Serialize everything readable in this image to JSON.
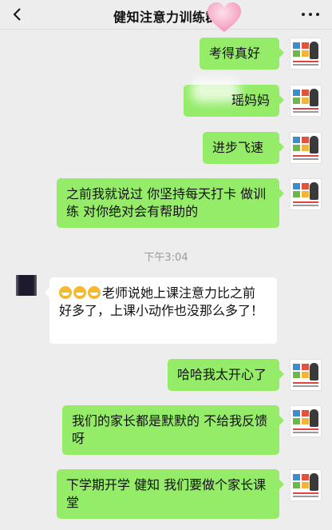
{
  "header": {
    "title": "健知注意力训练群",
    "back_icon": "chevron-left-icon",
    "more_icon": "more-dots-icon",
    "heart_color": "#f7a9c6"
  },
  "messages": [
    {
      "sender": "me",
      "text": "考得真好"
    },
    {
      "sender": "me",
      "text": "瑶妈妈"
    },
    {
      "sender": "me",
      "text": "进步飞速"
    },
    {
      "sender": "me",
      "text": "之前我就说过 你坚持每天打卡 做训练 对你绝对会有帮助的"
    },
    {
      "sender": "other",
      "text": "老师说她上课注意力比之前好多了，上课小动作也没那么多了！",
      "emoji_count": 3
    },
    {
      "sender": "me",
      "text": "哈哈我太开心了"
    },
    {
      "sender": "me",
      "text": "我们的家长都是默默的 不给我反馈呀"
    },
    {
      "sender": "me",
      "text": "下学期开学 健知 我们要做个家长课堂"
    }
  ],
  "timestamp": "下午3:04",
  "colors": {
    "bubble_me": "#95ec69",
    "bubble_other": "#ffffff",
    "background": "#ededed"
  }
}
